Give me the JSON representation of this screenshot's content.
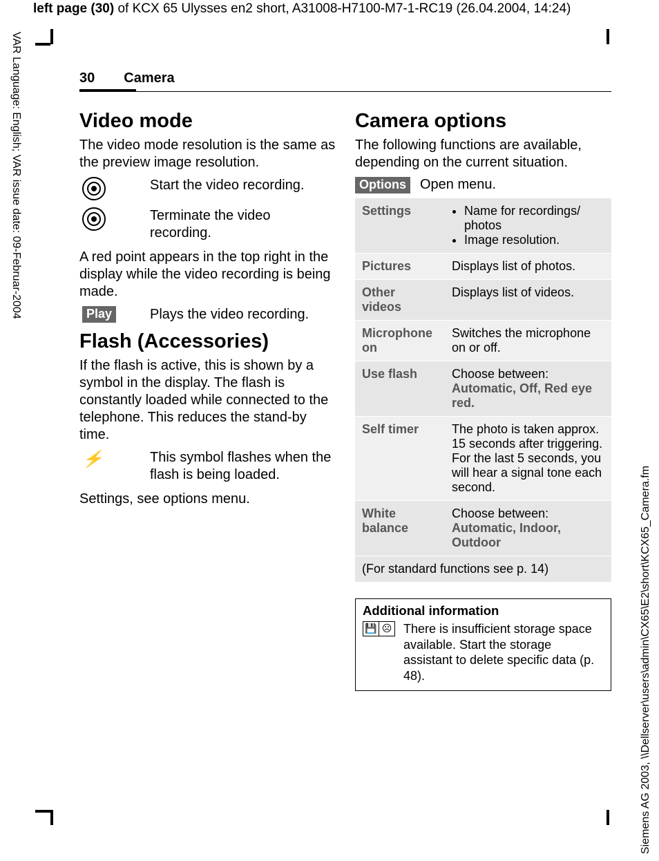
{
  "meta": {
    "top_header_prefix": "left page (30)",
    "top_header_rest": " of KCX 65 Ulysses en2 short, A31008-H7100-M7-1-RC19 (26.04.2004, 14:24)",
    "side_left": "VAR Language: English; VAR issue date: 09-Februar-2004",
    "side_right": "Siemens AG 2003, \\\\Dellserver\\users\\admin\\CX65\\E2\\short\\KCX65_Camera.fm"
  },
  "header": {
    "page_number": "30",
    "section": "Camera"
  },
  "left": {
    "video_mode": {
      "title": "Video mode",
      "intro": "The video mode resolution is the same as the preview image resolution.",
      "start": "Start the video recording.",
      "stop": "Terminate the video recording.",
      "red_point": "A red point appears in the top right in the display while the video recording is being made.",
      "play_key": "Play",
      "play_text": "Plays the video recording."
    },
    "flash": {
      "title": "Flash (Accessories)",
      "intro": "If the flash is active, this is shown by a symbol in the display. The flash is constantly loaded while connected to the telephone. This reduces the stand-by time.",
      "symbol_text": "This symbol flashes when the flash is being loaded.",
      "settings_note": "Settings, see options menu."
    }
  },
  "right": {
    "camera_options": {
      "title": "Camera options",
      "intro": "The following functions are available, depending on the current situation.",
      "options_key": "Options",
      "options_text": "Open menu.",
      "rows": {
        "settings": {
          "label": "Settings",
          "b1": "Name for recordings/ photos",
          "b2": "Image resolution."
        },
        "pictures": {
          "label": "Pictures",
          "text": "Displays list of photos."
        },
        "other_videos": {
          "label": "Other videos",
          "text": "Displays list of videos."
        },
        "microphone": {
          "label": "Microphone on",
          "text": "Switches the microphone on or off."
        },
        "use_flash": {
          "label": "Use flash",
          "lead": "Choose between:",
          "opts": "Automatic, Off, Red eye red."
        },
        "self_timer": {
          "label": "Self timer",
          "text": "The photo is taken approx. 15 seconds after triggering. For the last 5 seconds, you will hear a signal tone each second."
        },
        "white_balance": {
          "label": "White balance",
          "lead": "Choose between:",
          "opts": "Automatic, Indoor, Outdoor"
        }
      },
      "footer": "(For standard functions see p. 14)"
    },
    "info": {
      "title": "Additional information",
      "text": "There is insufficient storage space available. Start the storage assistant to delete specific data (p. 48)."
    }
  }
}
